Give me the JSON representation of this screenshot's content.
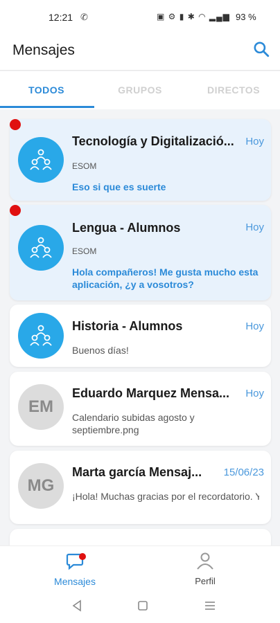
{
  "status": {
    "time": "12:21",
    "battery": "93 %"
  },
  "header": {
    "title": "Mensajes"
  },
  "tabs": [
    {
      "label": "TODOS"
    },
    {
      "label": "GRUPOS"
    },
    {
      "label": "DIRECTOS"
    }
  ],
  "conversations": [
    {
      "title": "Tecnología y Digitalizació...",
      "date": "Hoy",
      "subtitle": "ESOM",
      "message": "Eso si que es suerte",
      "unread": true
    },
    {
      "title": "Lengua - Alumnos",
      "date": "Hoy",
      "subtitle": "ESOM",
      "message": "Hola compañeros! Me gusta mucho esta aplicación, ¿y a vosotros?",
      "unread": true
    },
    {
      "title": "Historia - Alumnos",
      "date": "Hoy",
      "message": "Buenos días!",
      "unread": false
    },
    {
      "title": "Eduardo Marquez Mensa...",
      "date": "Hoy",
      "initials": "EM",
      "message": "Calendario subidas agosto y septiembre.png",
      "unread": false
    },
    {
      "title": "Marta garcía Mensaj...",
      "date": "15/06/23",
      "initials": "MG",
      "message": "¡Hola! Muchas gracias por el recordatorio. Ya estoy estudiando para",
      "unread": false
    }
  ],
  "bottom_nav": [
    {
      "label": "Mensajes"
    },
    {
      "label": "Perfil"
    }
  ],
  "colors": {
    "accent": "#2b8ad8",
    "avatar_blue": "#29a8e8",
    "unread_bg": "#e8f2fc",
    "badge_red": "#e01010"
  }
}
